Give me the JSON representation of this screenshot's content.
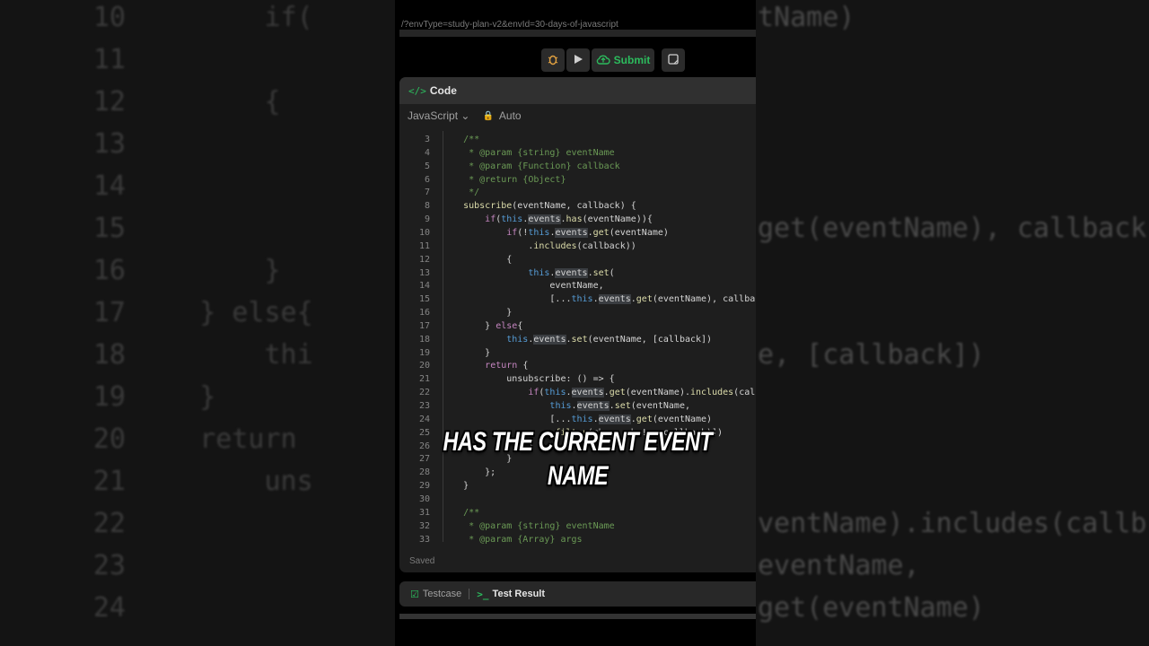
{
  "background": {
    "left_lines": [
      {
        "num": "10",
        "code": "        if("
      },
      {
        "num": "11",
        "code": ""
      },
      {
        "num": "12",
        "code": "        {"
      },
      {
        "num": "13",
        "code": ""
      },
      {
        "num": "14",
        "code": ""
      },
      {
        "num": "15",
        "code": ""
      },
      {
        "num": "16",
        "code": "        }"
      },
      {
        "num": "17",
        "code": "    } else{"
      },
      {
        "num": "18",
        "code": "        thi"
      },
      {
        "num": "19",
        "code": "    }"
      },
      {
        "num": "20",
        "code": "    return"
      },
      {
        "num": "21",
        "code": "        uns"
      },
      {
        "num": "22",
        "code": ""
      },
      {
        "num": "23",
        "code": ""
      },
      {
        "num": "24",
        "code": ""
      }
    ],
    "right_lines": [
      "tName)",
      "",
      "",
      "",
      "",
      "get(eventName), callback",
      "",
      "",
      "e, [callback])",
      "",
      "",
      "",
      "ventName).includes(callb",
      "eventName,",
      "get(eventName)"
    ]
  },
  "breadcrumb": "/?envType=study-plan-v2&envId=30-days-of-javascript",
  "toolbar": {
    "debug_icon": "bug-icon",
    "run_icon": "play-icon",
    "submit_label": "Submit",
    "submit_icon": "cloud-upload-icon",
    "note_icon": "note-icon"
  },
  "editor_panel": {
    "title": "Code",
    "language": "JavaScript",
    "mode": "Auto",
    "status": "Saved",
    "lines": [
      {
        "num": "3",
        "code": "    /**"
      },
      {
        "num": "4",
        "code": "     * @param {string} eventName"
      },
      {
        "num": "5",
        "code": "     * @param {Function} callback"
      },
      {
        "num": "6",
        "code": "     * @return {Object}"
      },
      {
        "num": "7",
        "code": "     */"
      },
      {
        "num": "8",
        "code": "    subscribe(eventName, callback) {"
      },
      {
        "num": "9",
        "code": "        if(this.events.has(eventName)){"
      },
      {
        "num": "10",
        "code": "            if(!this.events.get(eventName)"
      },
      {
        "num": "11",
        "code": "                .includes(callback))"
      },
      {
        "num": "12",
        "code": "            {"
      },
      {
        "num": "13",
        "code": "                this.events.set("
      },
      {
        "num": "14",
        "code": "                    eventName,"
      },
      {
        "num": "15",
        "code": "                    [...this.events.get(eventName), callback"
      },
      {
        "num": "16",
        "code": "            }"
      },
      {
        "num": "17",
        "code": "        } else{"
      },
      {
        "num": "18",
        "code": "            this.events.set(eventName, [callback])"
      },
      {
        "num": "19",
        "code": "        }"
      },
      {
        "num": "20",
        "code": "        return {"
      },
      {
        "num": "21",
        "code": "            unsubscribe: () => {"
      },
      {
        "num": "22",
        "code": "                if(this.events.get(eventName).includes(callb"
      },
      {
        "num": "23",
        "code": "                    this.events.set(eventName,"
      },
      {
        "num": "24",
        "code": "                    [...this.events.get(eventName)"
      },
      {
        "num": "25",
        "code": "                    .filter(cb => cb !== callback)])"
      },
      {
        "num": "26",
        "code": "                }"
      },
      {
        "num": "27",
        "code": "            }"
      },
      {
        "num": "28",
        "code": "        };"
      },
      {
        "num": "29",
        "code": "    }"
      },
      {
        "num": "30",
        "code": ""
      },
      {
        "num": "31",
        "code": "    /**"
      },
      {
        "num": "32",
        "code": "     * @param {string} eventName"
      },
      {
        "num": "33",
        "code": "     * @param {Array} args"
      }
    ]
  },
  "bottom_tabs": [
    {
      "label": "Testcase",
      "icon": "checkbox-icon"
    },
    {
      "label": "Test Result",
      "icon": "terminal-icon"
    }
  ],
  "caption": {
    "line1": "HAS THE CURRENT EVENT",
    "line2": "NAME"
  }
}
